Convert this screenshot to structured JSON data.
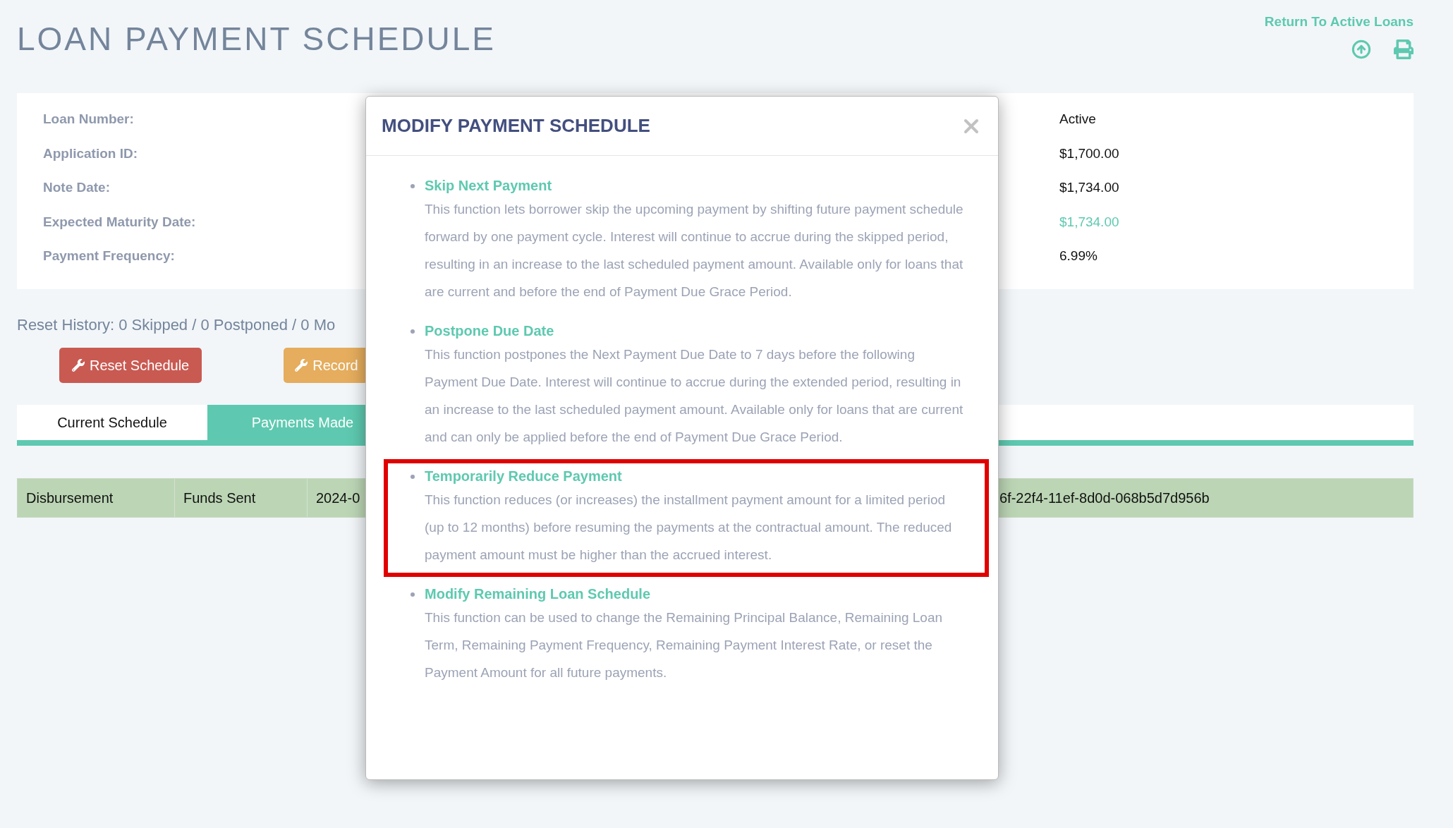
{
  "page_title": "LOAN PAYMENT SCHEDULE",
  "return_link": "Return To Active Loans",
  "info_card": {
    "labels": [
      "Loan Number:",
      "Application ID:",
      "Note Date:",
      "Expected Maturity Date:",
      "Payment Frequency:"
    ],
    "values": [
      {
        "text": "Active",
        "kind": "text"
      },
      {
        "text": "$1,700.00",
        "kind": "text"
      },
      {
        "text": "$1,734.00",
        "kind": "text"
      },
      {
        "text": "$1,734.00",
        "kind": "link"
      },
      {
        "text": "6.99%",
        "kind": "text"
      }
    ]
  },
  "reset_history": "Reset History: 0 Skipped / 0 Postponed / 0 Mo",
  "buttons": [
    {
      "label": "Reset Schedule",
      "kind": "danger"
    },
    {
      "label": "Record",
      "kind": "warning"
    }
  ],
  "tabs": [
    {
      "label": "Current Schedule",
      "selected": true
    },
    {
      "label": "Payments Made",
      "selected": false
    }
  ],
  "table": {
    "rows": [
      {
        "cells": [
          "Disbursement",
          "Funds Sent",
          "2024-0",
          "6f-22f4-11ef-8d0d-068b5d7d956b"
        ]
      }
    ]
  },
  "modal": {
    "title": "MODIFY PAYMENT SCHEDULE",
    "items": [
      {
        "title": "Skip Next Payment",
        "description": "This function lets borrower skip the upcoming payment by shifting future payment schedule forward by one payment cycle. Interest will continue to accrue during the skipped period, resulting in an increase to the last scheduled payment amount. Available only for loans that are current and before the end of Payment Due Grace Period.",
        "highlighted": false
      },
      {
        "title": "Postpone Due Date",
        "description": "This function postpones the Next Payment Due Date to 7 days before the following Payment Due Date. Interest will continue to accrue during the extended period, resulting in an increase to the last scheduled payment amount. Available only for loans that are current and can only be applied before the end of Payment Due Grace Period.",
        "highlighted": false
      },
      {
        "title": "Temporarily Reduce Payment",
        "description": "This function reduces (or increases) the installment payment amount for a limited period (up to 12 months) before resuming the payments at the contractual amount. The reduced payment amount must be higher than the accrued interest.",
        "highlighted": true
      },
      {
        "title": "Modify Remaining Loan Schedule",
        "description": "This function can be used to change the Remaining Principal Balance, Remaining Loan Term, Remaining Payment Frequency, Remaining Payment Interest Rate, or reset the Payment Amount for all future payments.",
        "highlighted": false
      }
    ]
  }
}
